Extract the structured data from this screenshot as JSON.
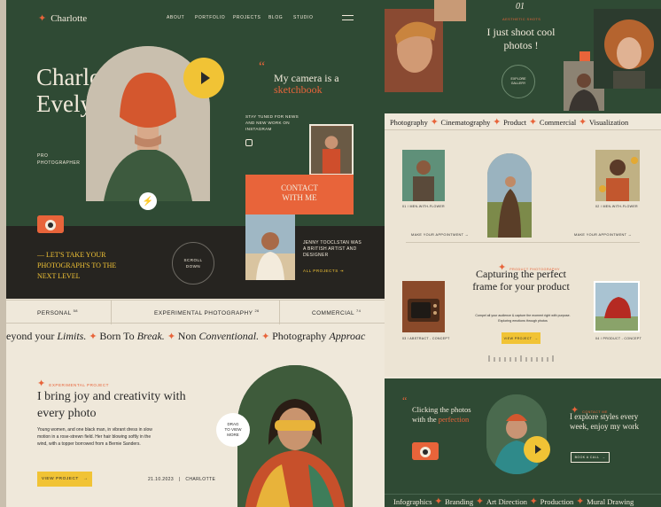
{
  "colors": {
    "green": "#2f4a34",
    "cream": "#efe8da",
    "orange": "#e8643a",
    "yellow": "#f1c335",
    "dark": "#262420"
  },
  "nav": {
    "logo": "Charlotte",
    "links": [
      "ABOUT",
      "PORTFOLIO",
      "PROJECTS",
      "BLOG",
      "STUDIO"
    ]
  },
  "hero": {
    "title_1": "Charlotte",
    "title_2": "Evelyn",
    "subtitle_1": "PRO",
    "subtitle_2": "PHOTOGRAPHER",
    "camera_line_1": "My camera is a",
    "camera_line_2": "sketchbook",
    "stay_tuned": "STAY TUNED FOR NEWS AND NEW WORK ON INSTAGRAM",
    "contact_1": "CONTACT",
    "contact_2": "WITH ME",
    "lets_take": "— LET'S TAKE YOUR PHOTOGRAPH'S TO THE NEXT LEVEL",
    "scroll_1": "SCROLL",
    "scroll_2": "DOWN",
    "jenny": "JENNY TOOCLSTAN WAS A BRITISH ARTIST AND DESIGNER",
    "all_projects": "ALL PROJECTS"
  },
  "categories": [
    {
      "label": "PERSONAL",
      "count": "58"
    },
    {
      "label": "EXPERIMENTAL PHOTOGRAPHY",
      "count": "26"
    },
    {
      "label": "COMMERCIAL",
      "count": "74"
    }
  ],
  "marquee": {
    "p1": "eyond your ",
    "p1i": "Limits.",
    "p2": "Born To ",
    "p2i": "Break.",
    "p3": "Non ",
    "p3i": "Conventional.",
    "p4": "Photography ",
    "p4i": "Approac"
  },
  "experimental": {
    "label": "EXPERIMENTAL PROJECT",
    "title": "I bring joy and creativity with every photo",
    "body": "Young women, and one black man, in vibrant dress in slow motion in a rose-strewn field. Her hair blowing softly in the wind, with a topper borrowed from a Bernie Sanders.",
    "button": "VIEW PROJECT",
    "date": "21.10.2023",
    "author": "CHARLOTTE",
    "drag_1": "DRAG",
    "drag_2": "TO VIEW",
    "drag_3": "MORE"
  },
  "right": {
    "num": "01",
    "aesthetic": "AESTHETIC SHOTS",
    "shoot": "I just shoot cool photos !",
    "explore_1": "EXPLORE",
    "explore_2": "GALLERY",
    "tags": [
      "Photography",
      "Cinematography",
      "Product",
      "Commercial",
      "Visualization"
    ],
    "card_1": "01 / MEN-WITH-FLOWER",
    "card_2": "02 / MEN-WITH-FLOWER",
    "make_appointment": "MAKE YOUR APPOINTMENT",
    "product_label": "PRODUCT PHOTOGRAPHY",
    "capture": "Capturing the perfect frame for your product",
    "capture_body": "Compel all your audience & capture the moment right with purpose. Exploring emotions through photos",
    "view_project": "VIEW PROJECT",
    "abstract": "03 / ABSTRACT - CONCEPT",
    "product_concept": "04 / PRODUCT - CONCEPT",
    "clicking_1": "Clicking the photos with the",
    "clicking_2": "perfection",
    "contact_label": "CONTACT ME",
    "explore_styles": "I explore styles every week, enjoy my work",
    "book_call": "BOOK A CALL",
    "footer_tags": [
      "Infographics",
      "Branding",
      "Art Direction",
      "Production",
      "Mural Drawing"
    ]
  },
  "icons": [
    "star-icon",
    "menu-icon",
    "play-icon",
    "bolt-icon",
    "instagram-icon",
    "camera-icon",
    "arrow-right-icon"
  ]
}
